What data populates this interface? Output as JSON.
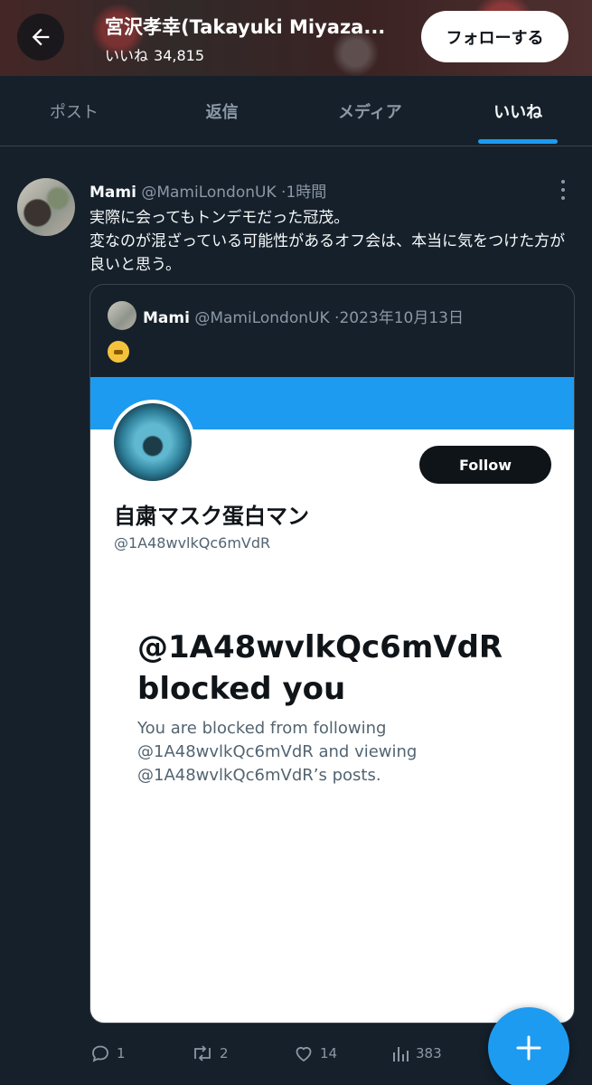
{
  "header": {
    "title": "宮沢孝幸(Takayuki Miyaza...",
    "likes_label": "いいね",
    "likes_count": "34,815",
    "follow_label": "フォローする"
  },
  "tabs": [
    {
      "label": "ポスト"
    },
    {
      "label": "返信"
    },
    {
      "label": "メディア"
    },
    {
      "label": "いいね",
      "active": true
    }
  ],
  "post": {
    "name": "Mami",
    "handle": "@MamiLondonUK",
    "time": "1時間",
    "text_line1": "実際に会ってもトンデモだった冠茂。",
    "text_line2": "変なのが混ざっている可能性があるオフ会は、本当に気をつけた方が良いと思う。",
    "quote": {
      "name": "Mami",
      "handle": "@MamiLondonUK",
      "date": "2023年10月13日",
      "emoji": "face-with-closed-mouth",
      "screenshot": {
        "follow_label": "Follow",
        "display_name": "自粛マスク蛋白マン",
        "handle": "@1A48wvlkQc6mVdR",
        "blocked_line1": "@1A48wvlkQc6mVdR",
        "blocked_line2": "blocked you",
        "desc_line1": "You are blocked from following",
        "desc_line2": "@1A48wvlkQc6mVdR and viewing",
        "desc_line3": "@1A48wvlkQc6mVdR’s posts."
      }
    },
    "actions": {
      "replies": "1",
      "reposts": "2",
      "likes": "14",
      "views": "383"
    }
  },
  "colors": {
    "background": "#15202b",
    "accent": "#1d9bf0",
    "muted": "#8b98a5"
  }
}
